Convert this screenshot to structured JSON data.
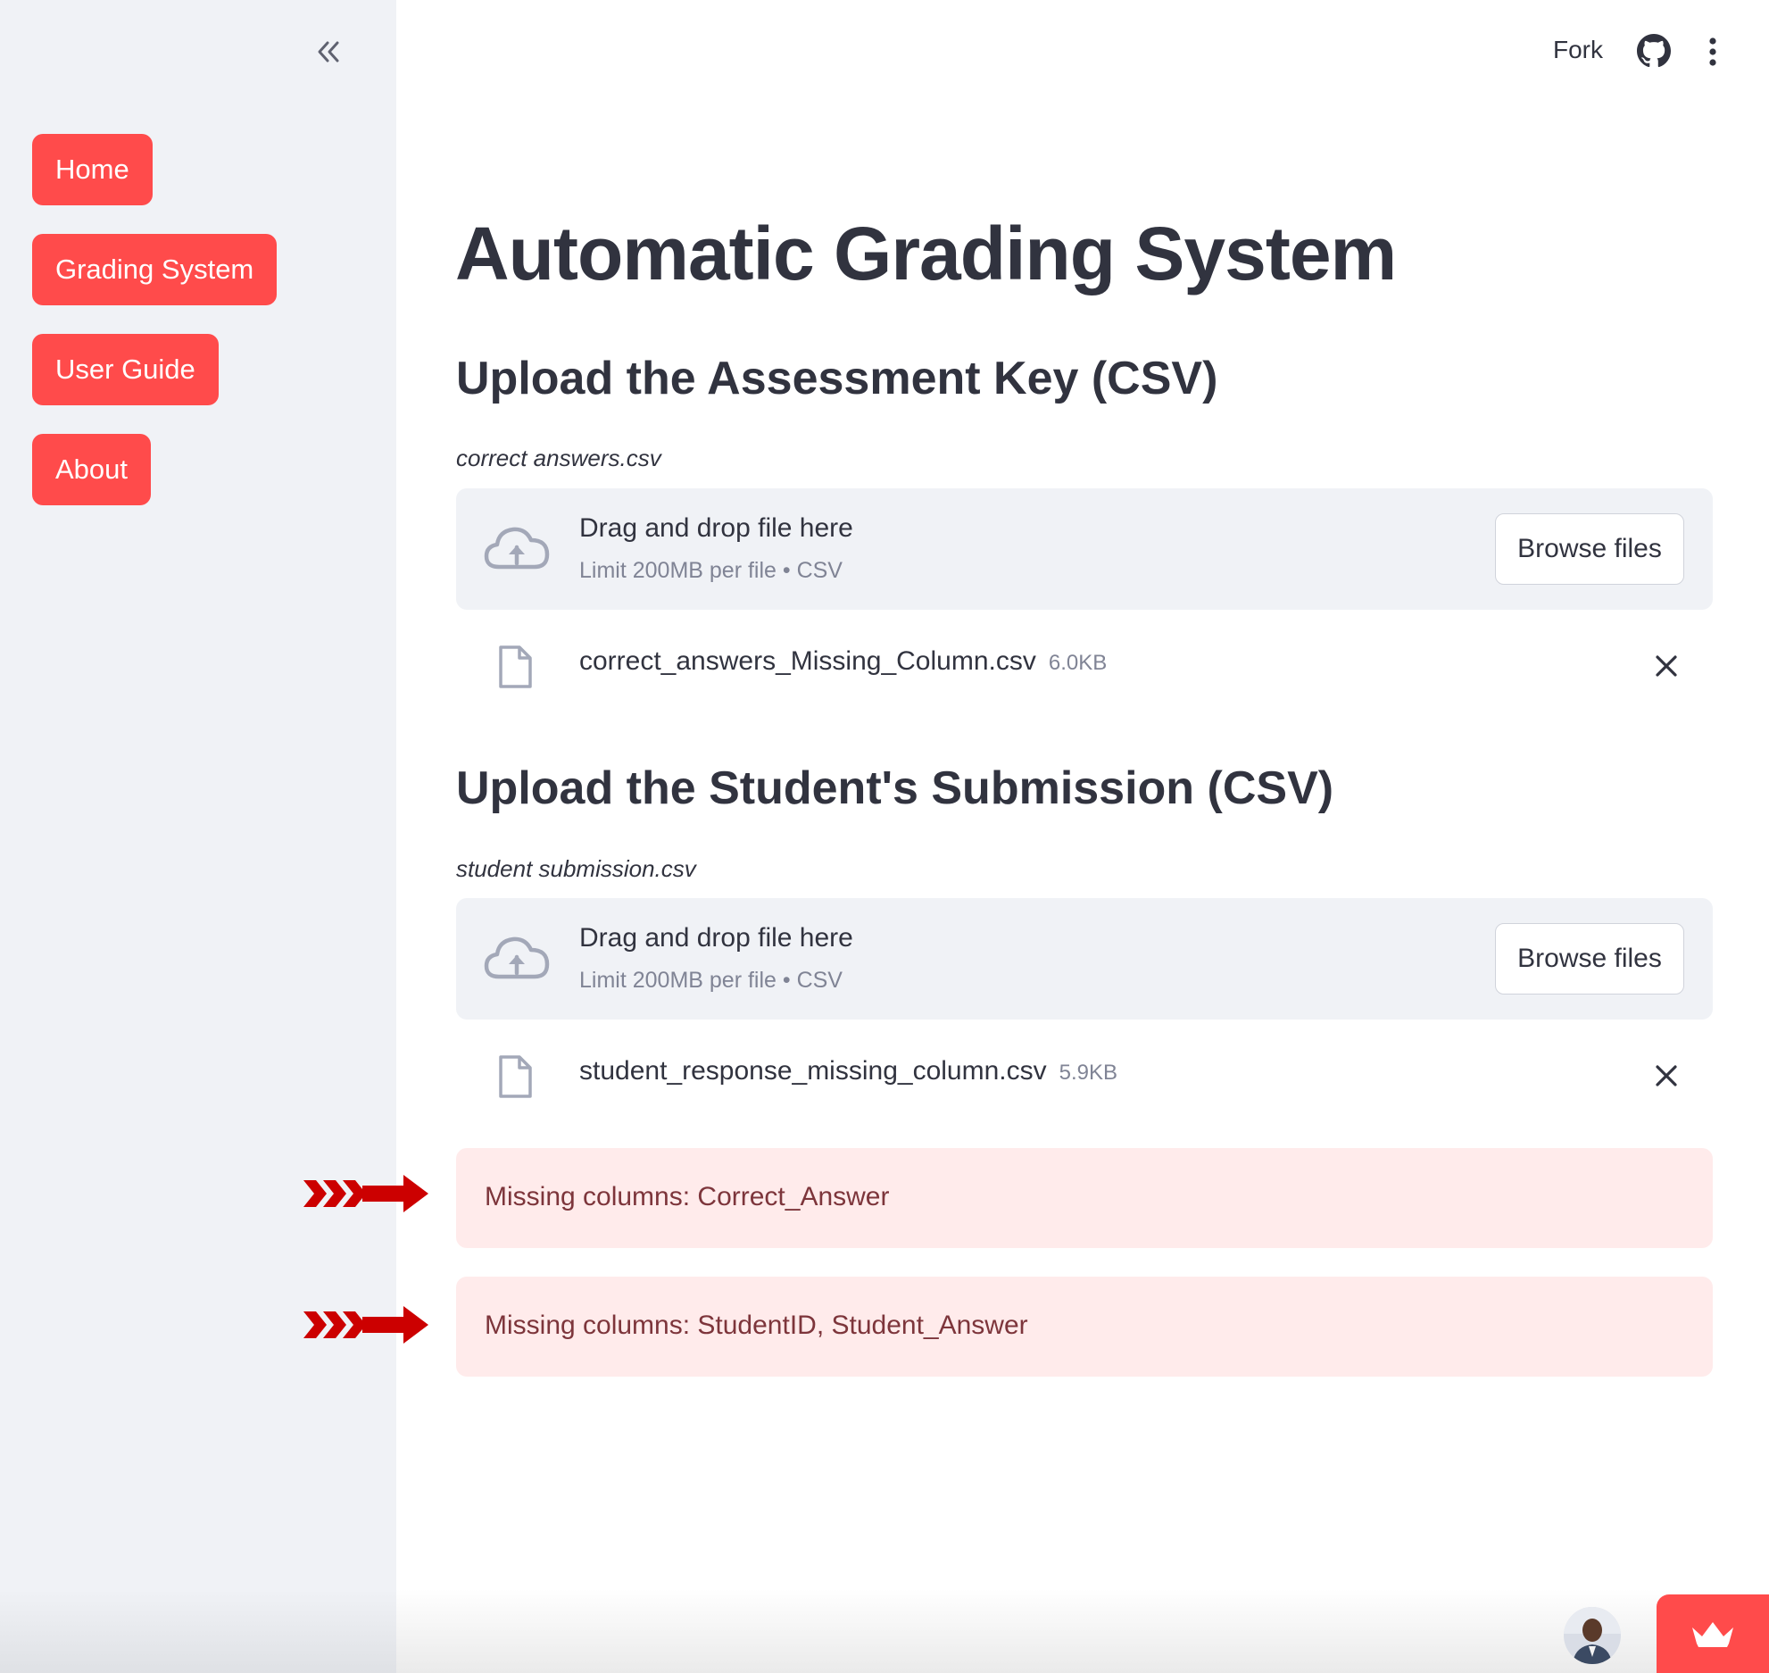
{
  "sidebar": {
    "collapse_icon": "double-chevron-left-icon",
    "nav": [
      {
        "label": "Home"
      },
      {
        "label": "Grading System"
      },
      {
        "label": "User Guide"
      },
      {
        "label": "About"
      }
    ],
    "accent_color": "#ff4b4b"
  },
  "header": {
    "fork_label": "Fork",
    "github_icon": "github-icon",
    "menu_icon": "vertical-dots-icon"
  },
  "main": {
    "title": "Automatic Grading System",
    "sections": [
      {
        "heading": "Upload the Assessment Key (CSV)",
        "field_label": "correct answers.csv",
        "dropzone": {
          "main_text": "Drag and drop file here",
          "sub_text": "Limit 200MB per file • CSV",
          "browse_label": "Browse files"
        },
        "file": {
          "name": "correct_answers_Missing_Column.csv",
          "size": "6.0KB"
        }
      },
      {
        "heading": "Upload the Student's Submission (CSV)",
        "field_label": "student submission.csv",
        "dropzone": {
          "main_text": "Drag and drop file here",
          "sub_text": "Limit 200MB per file • CSV",
          "browse_label": "Browse files"
        },
        "file": {
          "name": "student_response_missing_column.csv",
          "size": "5.9KB"
        }
      }
    ],
    "errors": [
      {
        "text": "Missing columns: Correct_Answer"
      },
      {
        "text": "Missing columns: StudentID, Student_Answer"
      }
    ],
    "error_bg_color": "#ffebeb",
    "error_text_color": "#7d353b"
  },
  "footer": {
    "avatar_icon": "user-avatar",
    "badge_icon": "streamlit-crown-icon"
  }
}
